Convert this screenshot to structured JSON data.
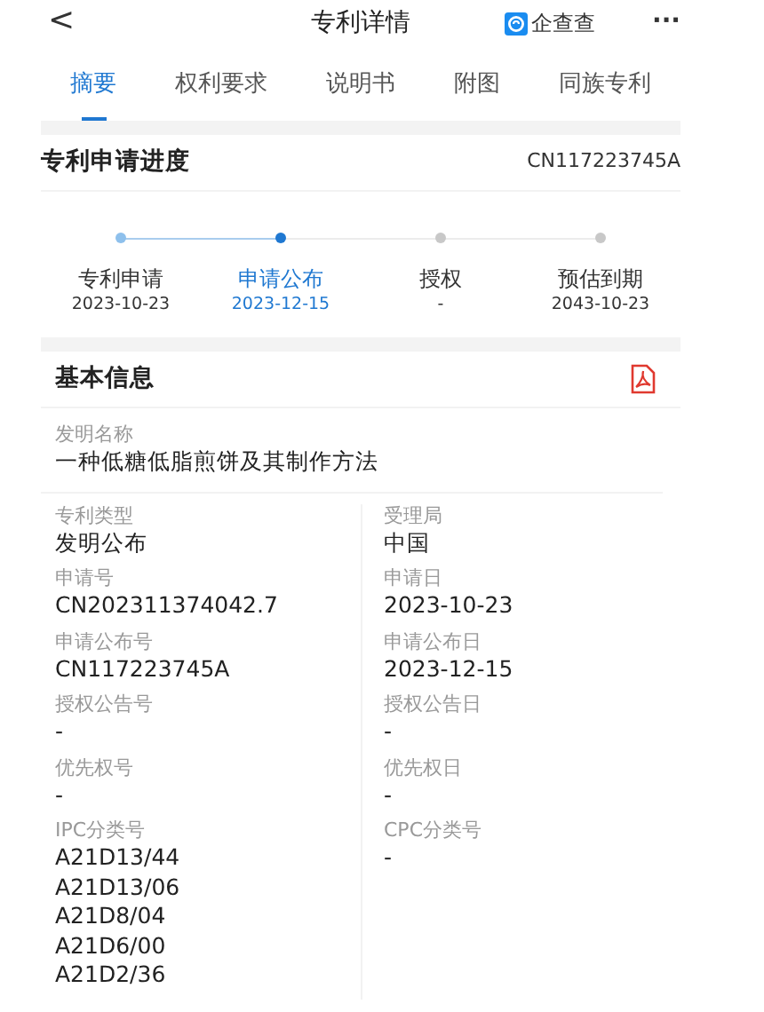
{
  "header": {
    "back": "<",
    "title": "专利详情",
    "brand": "企查查",
    "more": "···"
  },
  "tabs": [
    {
      "label": "摘要",
      "selected": true
    },
    {
      "label": "权利要求",
      "selected": false
    },
    {
      "label": "说明书",
      "selected": false
    },
    {
      "label": "附图",
      "selected": false
    },
    {
      "label": "同族专利",
      "selected": false
    }
  ],
  "progress": {
    "title": "专利申请进度",
    "number": "CN117223745A",
    "steps": [
      {
        "label": "专利申请",
        "date": "2023-10-23",
        "completed": true,
        "selected": false
      },
      {
        "label": "申请公布",
        "date": "2023-12-15",
        "completed": true,
        "selected": true
      },
      {
        "label": "授权",
        "date": "-",
        "completed": false,
        "selected": false
      },
      {
        "label": "预估到期",
        "date": "2043-10-23",
        "completed": false,
        "selected": false
      }
    ]
  },
  "basic_info": {
    "title": "基本信息",
    "invention_name": {
      "label": "发明名称",
      "value": "一种低糖低脂煎饼及其制作方法"
    },
    "fields": [
      [
        {
          "label": "专利类型",
          "value": "发明公布"
        },
        {
          "label": "受理局",
          "value": "中国"
        }
      ],
      [
        {
          "label": "申请号",
          "value": "CN202311374042.7"
        },
        {
          "label": "申请日",
          "value": "2023-10-23"
        }
      ],
      [
        {
          "label": "申请公布号",
          "value": "CN117223745A"
        },
        {
          "label": "申请公布日",
          "value": "2023-12-15"
        }
      ],
      [
        {
          "label": "授权公告号",
          "value": "-"
        },
        {
          "label": "授权公告日",
          "value": "-"
        }
      ],
      [
        {
          "label": "优先权号",
          "value": "-"
        },
        {
          "label": "优先权日",
          "value": "-"
        }
      ],
      [
        {
          "label": "IPC分类号",
          "values": [
            "A21D13/44",
            "A21D13/06",
            "A21D8/04",
            "A21D6/00",
            "A21D2/36"
          ]
        },
        {
          "label": "CPC分类号",
          "value": "-"
        }
      ]
    ]
  }
}
